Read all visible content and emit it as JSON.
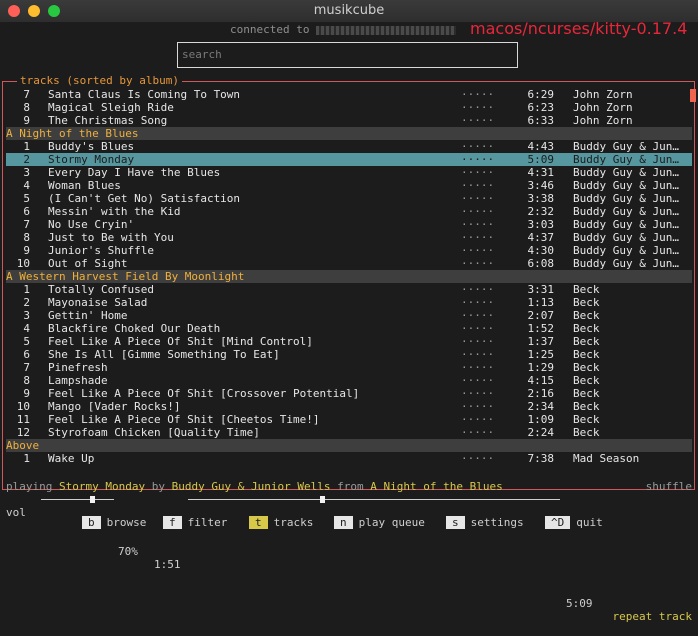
{
  "window": {
    "title": "musikcube"
  },
  "overlay_label": "macos/ncurses/kitty-0.17.4",
  "connection": {
    "prefix": "connected to"
  },
  "search": {
    "placeholder": "search"
  },
  "tracks_panel": {
    "title": "tracks (sorted by album)",
    "rows": [
      {
        "type": "track",
        "num": "7",
        "title": "Santa Claus Is Coming To Town",
        "rating": "·····",
        "duration": "6:29",
        "artist": "John Zorn"
      },
      {
        "type": "track",
        "num": "8",
        "title": "Magical Sleigh Ride",
        "rating": "·····",
        "duration": "6:23",
        "artist": "John Zorn"
      },
      {
        "type": "track",
        "num": "9",
        "title": "The Christmas Song",
        "rating": "·····",
        "duration": "6:33",
        "artist": "John Zorn"
      },
      {
        "type": "header",
        "title": "A Night of the Blues"
      },
      {
        "type": "track",
        "num": "1",
        "title": "Buddy's Blues",
        "rating": "·····",
        "duration": "4:43",
        "artist": "Buddy Guy & Jun…"
      },
      {
        "type": "track",
        "num": "2",
        "title": "Stormy Monday",
        "rating": "·····",
        "duration": "5:09",
        "artist": "Buddy Guy & Jun…",
        "selected": true
      },
      {
        "type": "track",
        "num": "3",
        "title": "Every Day I Have the Blues",
        "rating": "·····",
        "duration": "4:31",
        "artist": "Buddy Guy & Jun…"
      },
      {
        "type": "track",
        "num": "4",
        "title": "Woman Blues",
        "rating": "·····",
        "duration": "3:46",
        "artist": "Buddy Guy & Jun…"
      },
      {
        "type": "track",
        "num": "5",
        "title": "(I Can't Get No) Satisfaction",
        "rating": "·····",
        "duration": "3:38",
        "artist": "Buddy Guy & Jun…"
      },
      {
        "type": "track",
        "num": "6",
        "title": "Messin' with the Kid",
        "rating": "·····",
        "duration": "2:32",
        "artist": "Buddy Guy & Jun…"
      },
      {
        "type": "track",
        "num": "7",
        "title": "No Use Cryin'",
        "rating": "·····",
        "duration": "3:03",
        "artist": "Buddy Guy & Jun…"
      },
      {
        "type": "track",
        "num": "8",
        "title": "Just to Be with You",
        "rating": "·····",
        "duration": "4:37",
        "artist": "Buddy Guy & Jun…"
      },
      {
        "type": "track",
        "num": "9",
        "title": "Junior's Shuffle",
        "rating": "·····",
        "duration": "4:30",
        "artist": "Buddy Guy & Jun…"
      },
      {
        "type": "track",
        "num": "10",
        "title": "Out of Sight",
        "rating": "·····",
        "duration": "6:08",
        "artist": "Buddy Guy & Jun…"
      },
      {
        "type": "header",
        "title": "A Western Harvest Field By Moonlight"
      },
      {
        "type": "track",
        "num": "1",
        "title": "Totally Confused",
        "rating": "·····",
        "duration": "3:31",
        "artist": "Beck"
      },
      {
        "type": "track",
        "num": "2",
        "title": "Mayonaise Salad",
        "rating": "·····",
        "duration": "1:13",
        "artist": "Beck"
      },
      {
        "type": "track",
        "num": "3",
        "title": "Gettin' Home",
        "rating": "·····",
        "duration": "2:07",
        "artist": "Beck"
      },
      {
        "type": "track",
        "num": "4",
        "title": "Blackfire Choked Our Death",
        "rating": "·····",
        "duration": "1:52",
        "artist": "Beck"
      },
      {
        "type": "track",
        "num": "5",
        "title": "Feel Like A Piece Of Shit [Mind Control]",
        "rating": "·····",
        "duration": "1:37",
        "artist": "Beck"
      },
      {
        "type": "track",
        "num": "6",
        "title": "She Is All [Gimme Something To Eat]",
        "rating": "·····",
        "duration": "1:25",
        "artist": "Beck"
      },
      {
        "type": "track",
        "num": "7",
        "title": "Pinefresh",
        "rating": "·····",
        "duration": "1:29",
        "artist": "Beck"
      },
      {
        "type": "track",
        "num": "8",
        "title": "Lampshade",
        "rating": "·····",
        "duration": "4:15",
        "artist": "Beck"
      },
      {
        "type": "track",
        "num": "9",
        "title": "Feel Like A Piece Of Shit [Crossover Potential]",
        "rating": "·····",
        "duration": "2:16",
        "artist": "Beck"
      },
      {
        "type": "track",
        "num": "10",
        "title": "Mango [Vader Rocks!]",
        "rating": "·····",
        "duration": "2:34",
        "artist": "Beck"
      },
      {
        "type": "track",
        "num": "11",
        "title": "Feel Like A Piece Of Shit [Cheetos Time!]",
        "rating": "·····",
        "duration": "1:09",
        "artist": "Beck"
      },
      {
        "type": "track",
        "num": "12",
        "title": "Styrofoam Chicken [Quality Time]",
        "rating": "·····",
        "duration": "2:24",
        "artist": "Beck"
      },
      {
        "type": "header",
        "title": "Above"
      },
      {
        "type": "track",
        "num": "1",
        "title": "Wake Up",
        "rating": "·····",
        "duration": "7:38",
        "artist": "Mad Season"
      }
    ]
  },
  "now_playing": {
    "w_playing": "playing",
    "title": "Stormy Monday",
    "w_by": "by",
    "artist": "Buddy Guy & Junior Wells",
    "w_from": "from",
    "album": "A Night of the Blues",
    "shuffle": "shuffle"
  },
  "transport": {
    "vol_label": "vol",
    "volume_pct": "70%",
    "volume_level": 0.7,
    "elapsed": "1:51",
    "total": "5:09",
    "progress": 0.36,
    "repeat": "repeat track"
  },
  "shortcuts": [
    {
      "key": "b",
      "label": "browse",
      "active": false
    },
    {
      "key": "f",
      "label": "filter",
      "active": false
    },
    {
      "key": "t",
      "label": "tracks",
      "active": true
    },
    {
      "key": "n",
      "label": "play queue",
      "active": false
    },
    {
      "key": "s",
      "label": "settings",
      "active": false
    },
    {
      "key": "^D",
      "label": "quit",
      "active": false
    }
  ]
}
